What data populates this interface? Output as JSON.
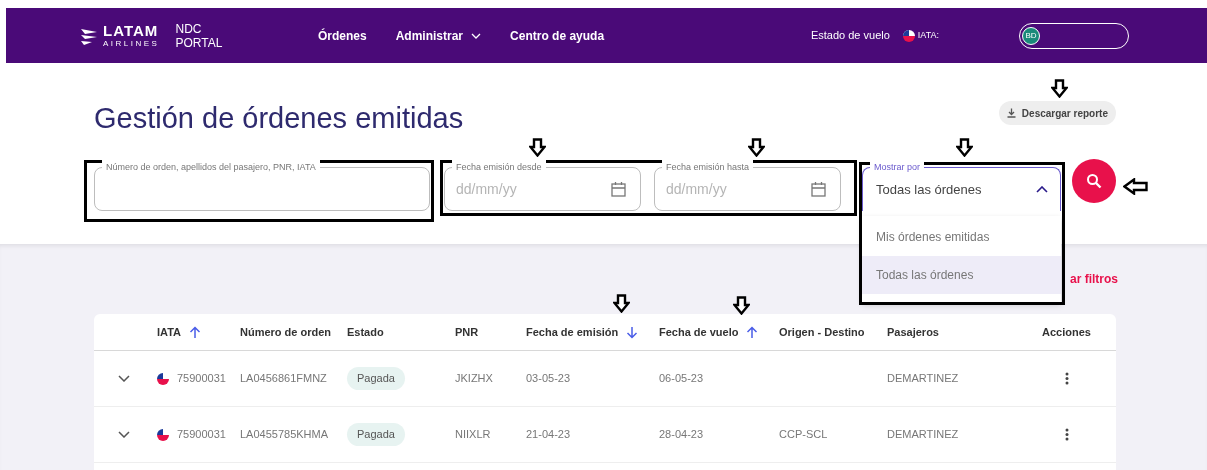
{
  "header": {
    "logo": {
      "brand": "LATAM",
      "sub": "AIRLINES"
    },
    "portal": [
      "NDC",
      "PORTAL"
    ],
    "nav": [
      {
        "label": "Órdenes",
        "dropdown": false
      },
      {
        "label": "Administrar",
        "dropdown": true
      },
      {
        "label": "Centro de ayuda",
        "dropdown": false
      }
    ],
    "flight_status": "Estado de vuelo",
    "iata_label": "IATA:",
    "user_initials": "BD"
  },
  "title": "Gestión de órdenes emitidas",
  "download_button": "Descargar reporte",
  "filters": {
    "search": {
      "label": "Número de orden, apellidos del pasajero, PNR, IATA"
    },
    "date_from": {
      "label": "Fecha emisión desde",
      "placeholder": "dd/mm/yy"
    },
    "date_to": {
      "label": "Fecha emisión hasta",
      "placeholder": "dd/mm/yy"
    },
    "show_by": {
      "label": "Mostrar por",
      "value": "Todas las órdenes",
      "expanded": true,
      "options": [
        {
          "label": "Mis órdenes emitidas",
          "selected": false
        },
        {
          "label": "Todas las órdenes",
          "selected": true
        }
      ]
    }
  },
  "clear_filters": "ar filtros",
  "table": {
    "columns": [
      {},
      {
        "label": "IATA",
        "sort_ascending": true
      },
      {
        "label": "Número de orden"
      },
      {
        "label": "Estado"
      },
      {
        "label": "PNR"
      },
      {
        "label": "Fecha de emisión",
        "sort_ascending": false
      },
      {
        "label": "Fecha de vuelo",
        "sort_ascending": true
      },
      {
        "label": "Origen - Destino"
      },
      {
        "label": "Pasajeros"
      },
      {
        "label": "Acciones"
      }
    ],
    "rows": [
      {
        "iata": "75900031",
        "order": "LA0456861FMNZ",
        "status": "Pagada",
        "pnr": "JKIZHX",
        "issued": "03-05-23",
        "flight": "06-05-23",
        "passengers": "DEMARTINEZ"
      },
      {
        "iata": "75900031",
        "order": "LA0455785KHMA",
        "status": "Pagada",
        "pnr": "NIIXLR",
        "issued": "21-04-23",
        "flight": "28-04-23",
        "route": "CCP-SCL",
        "passengers": "DEMARTINEZ"
      }
    ]
  }
}
